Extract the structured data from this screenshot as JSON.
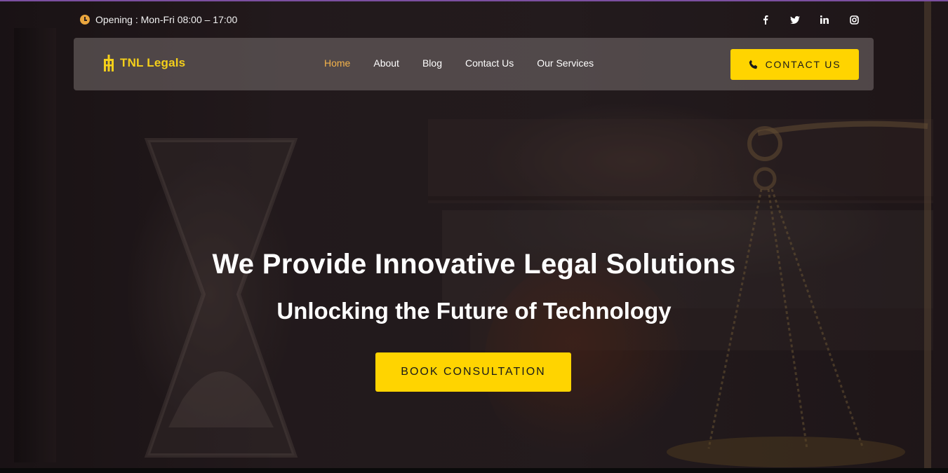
{
  "topbar": {
    "hours_text": "Opening : Mon-Fri 08:00 – 17:00",
    "clock_icon": "clock-icon",
    "socials": [
      {
        "name": "facebook-icon",
        "glyph": "f"
      },
      {
        "name": "twitter-icon",
        "glyph": "t"
      },
      {
        "name": "linkedin-icon",
        "glyph": "in"
      },
      {
        "name": "instagram-icon",
        "glyph": "ig"
      }
    ]
  },
  "nav": {
    "brand_name": "TNL Legals",
    "logo_icon": "tnl-logo-icon",
    "items": [
      {
        "label": "Home",
        "active": true
      },
      {
        "label": "About",
        "active": false
      },
      {
        "label": "Blog",
        "active": false
      },
      {
        "label": "Contact Us",
        "active": false
      },
      {
        "label": "Our Services",
        "active": false
      }
    ],
    "cta_label": "CONTACT US",
    "cta_icon": "phone-icon"
  },
  "hero": {
    "headline": "We Provide Innovative Legal Solutions",
    "subheadline": "Unlocking the Future of Technology",
    "cta_label": "BOOK CONSULTATION"
  },
  "colors": {
    "accent": "#ffd400",
    "brand": "#f4cf1a",
    "active_nav": "#f4b34a",
    "clock": "#e9a53d",
    "top_line": "#7b4fa0"
  }
}
